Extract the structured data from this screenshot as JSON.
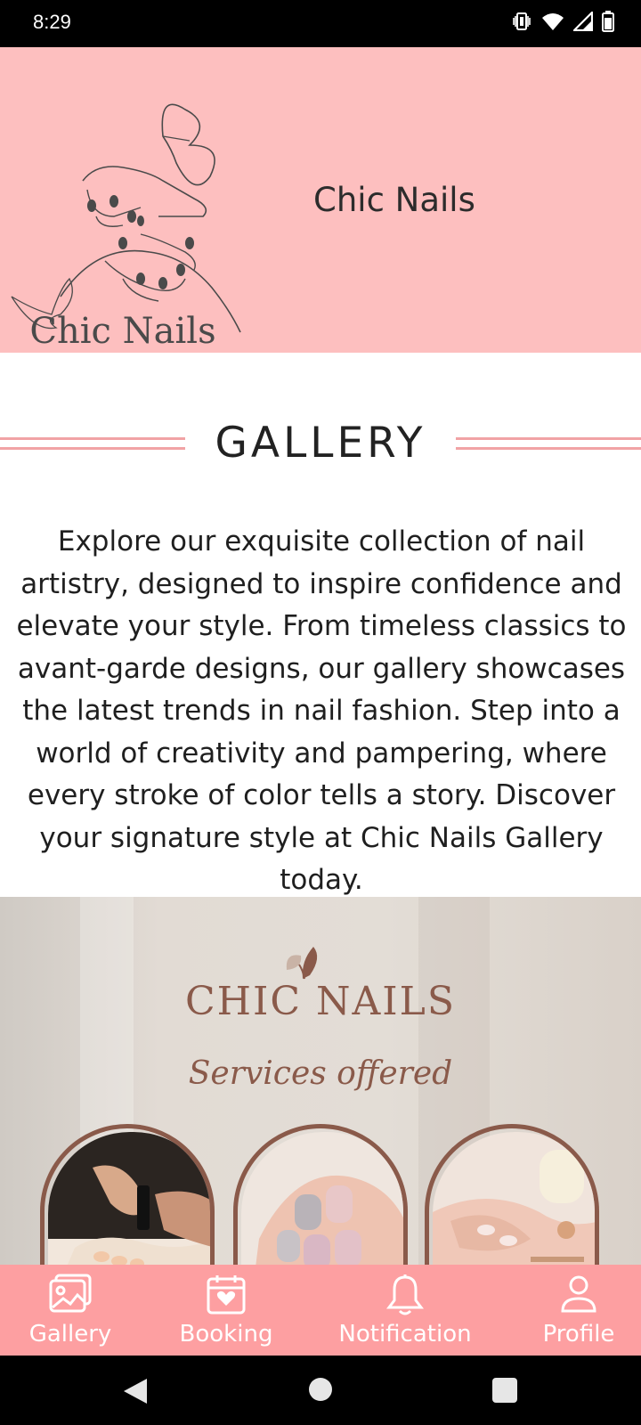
{
  "status_bar": {
    "time": "8:29",
    "icons": [
      "vibrate-icon",
      "wifi-icon",
      "signal-icon",
      "battery-icon"
    ]
  },
  "header": {
    "logo_text": "Chic Nails",
    "title": "Chic Nails",
    "background": "#fdbfbf"
  },
  "gallery": {
    "title": "GALLERY",
    "description": "Explore our exquisite collection of nail artistry, designed to inspire confidence and elevate your style. From timeless classics to avant-garde designs, our gallery showcases the latest trends in nail fashion. Step into a world of creativity and pampering, where every stroke of color tells a story. Discover your signature style at Chic Nails Gallery today.",
    "line_color": "#f1a3a5"
  },
  "banner": {
    "brand": "CHIC NAILS",
    "subtitle": "Services offered",
    "brand_color": "#8a5a4a"
  },
  "bottom_nav": {
    "background": "#fd9fa1",
    "items": [
      {
        "label": "Gallery",
        "icon": "gallery-icon"
      },
      {
        "label": "Booking",
        "icon": "calendar-heart-icon"
      },
      {
        "label": "Notification",
        "icon": "bell-icon"
      },
      {
        "label": "Profile",
        "icon": "person-icon"
      }
    ]
  },
  "system_nav": {
    "icons": [
      "back-icon",
      "home-icon",
      "recents-icon"
    ]
  }
}
